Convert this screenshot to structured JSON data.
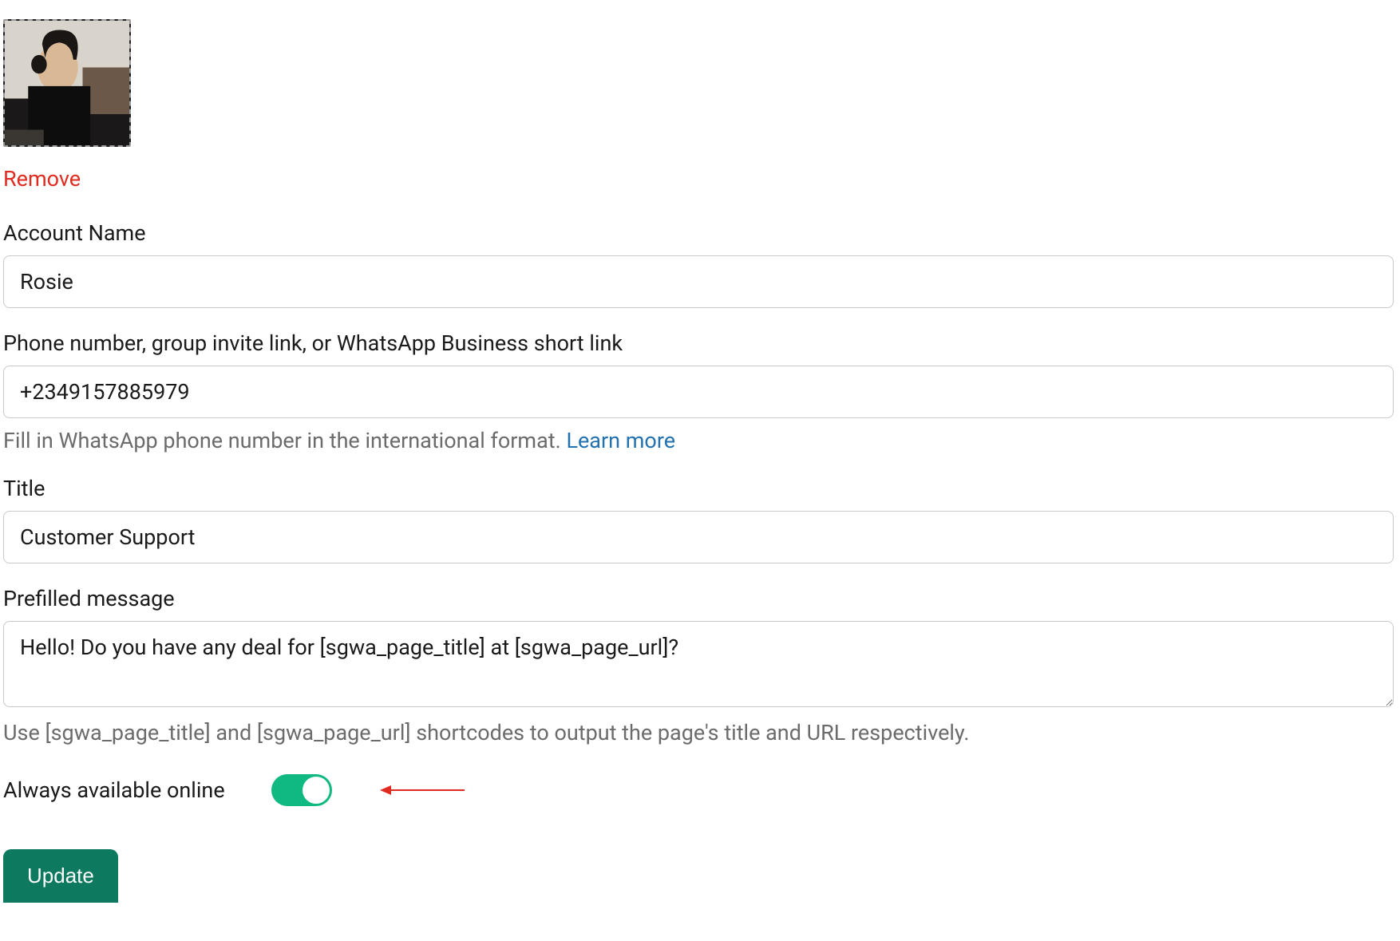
{
  "avatar": {
    "remove_label": "Remove"
  },
  "fields": {
    "account_name": {
      "label": "Account Name",
      "value": "Rosie"
    },
    "phone": {
      "label": "Phone number, group invite link, or WhatsApp Business short link",
      "value": "+2349157885979",
      "helper_prefix": "Fill in WhatsApp phone number in the international format. ",
      "learn_more": "Learn more"
    },
    "title": {
      "label": "Title",
      "value": "Customer Support"
    },
    "prefilled": {
      "label": "Prefilled message",
      "value": "Hello! Do you have any deal for [sgwa_page_title] at [sgwa_page_url]?",
      "helper": "Use [sgwa_page_title] and [sgwa_page_url] shortcodes to output the page's title and URL respectively."
    }
  },
  "toggle": {
    "label": "Always available online",
    "checked": true
  },
  "buttons": {
    "update": "Update"
  },
  "colors": {
    "danger": "#e02b20",
    "link": "#2271b1",
    "toggle_on": "#10b981",
    "primary": "#0d7a5f"
  }
}
